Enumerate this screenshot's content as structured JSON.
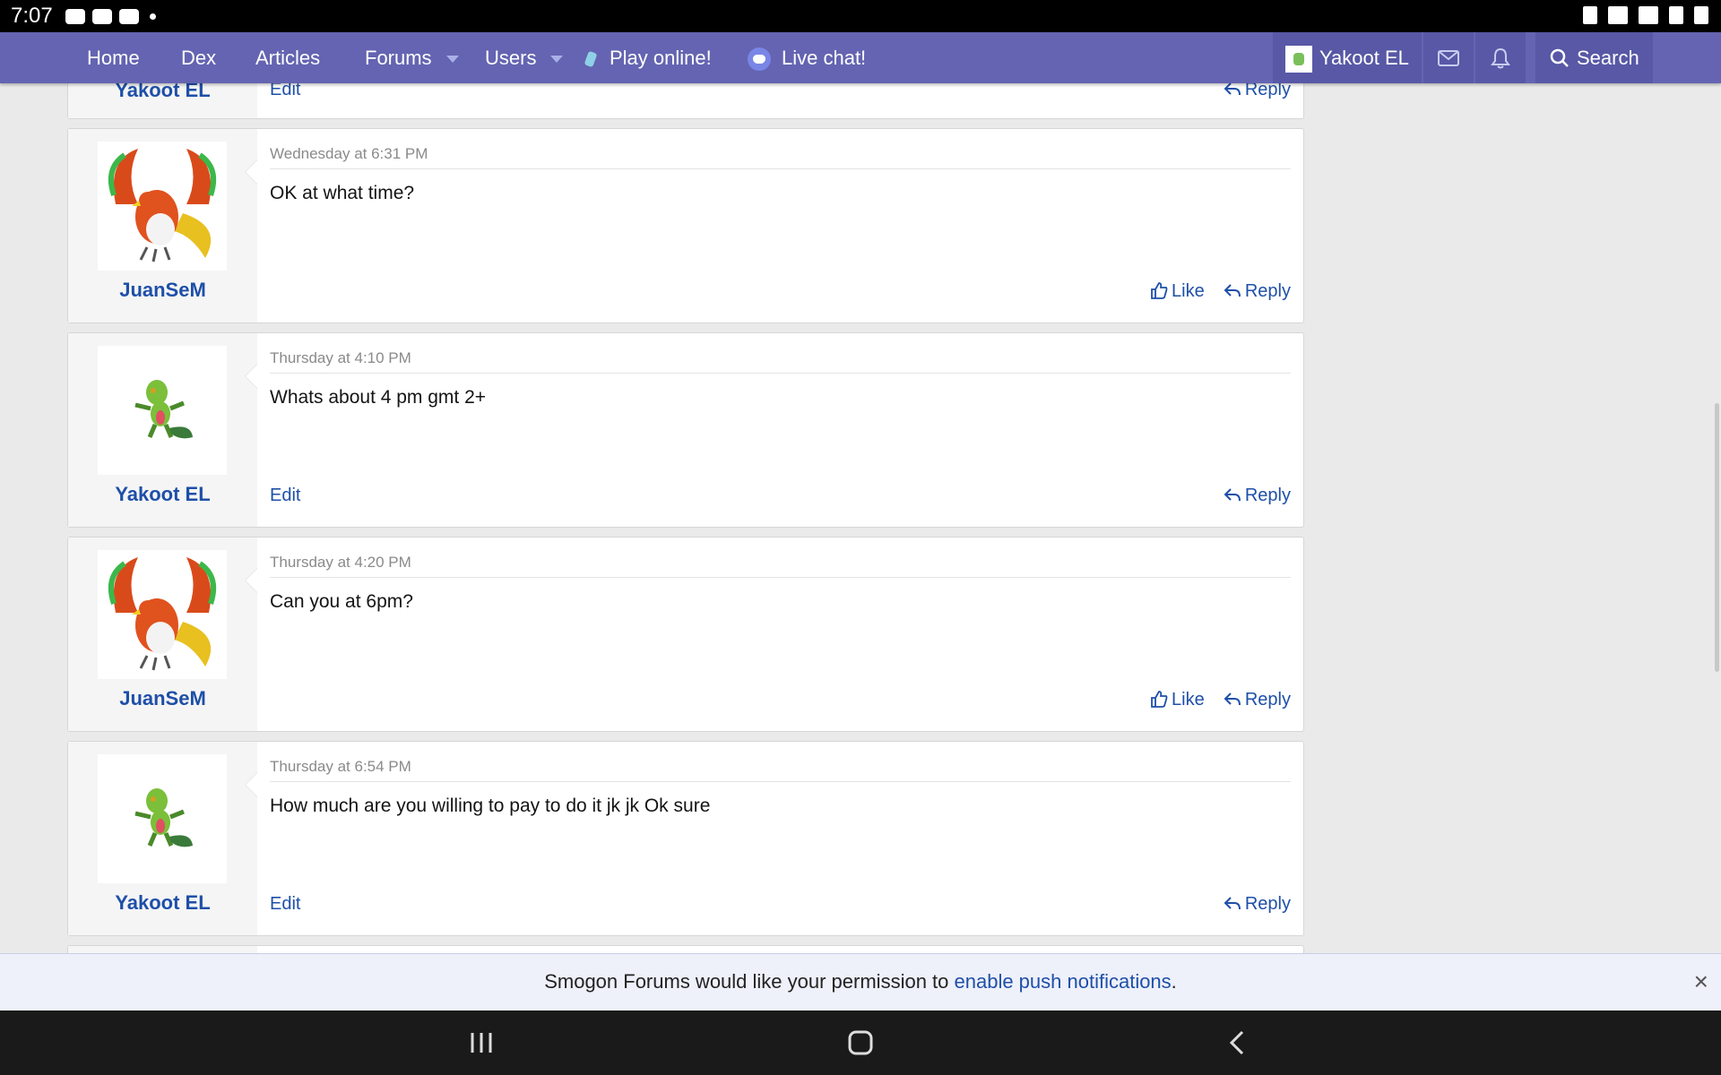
{
  "status_bar": {
    "time": "7:07"
  },
  "nav": {
    "home": "Home",
    "dex": "Dex",
    "articles": "Articles",
    "forums": "Forums",
    "users": "Users",
    "play": "Play online!",
    "chat": "Live chat!",
    "account": "Yakoot EL",
    "search": "Search"
  },
  "posts": [
    {
      "username": "Yakoot EL",
      "actions": {
        "edit": "Edit",
        "reply": "Reply"
      }
    },
    {
      "username": "JuanSeM",
      "date": "Wednesday at 6:31 PM",
      "body": "OK at what time?",
      "actions": {
        "like": "Like",
        "reply": "Reply"
      }
    },
    {
      "username": "Yakoot EL",
      "date": "Thursday at 4:10 PM",
      "body": "Whats about 4 pm gmt 2+",
      "actions": {
        "edit": "Edit",
        "reply": "Reply"
      }
    },
    {
      "username": "JuanSeM",
      "date": "Thursday at 4:20 PM",
      "body": "Can you at 6pm?",
      "actions": {
        "like": "Like",
        "reply": "Reply"
      }
    },
    {
      "username": "Yakoot EL",
      "date": "Thursday at 6:54 PM",
      "body": "How much are you willing to pay to do it jk jk Ok sure",
      "actions": {
        "edit": "Edit",
        "reply": "Reply"
      }
    }
  ],
  "banner": {
    "text": "Smogon Forums would like your permission to ",
    "link": "enable push notifications",
    "suffix": ".",
    "close": "×"
  },
  "colors": {
    "nav": "#6464b2",
    "link": "#1e4fa8"
  }
}
